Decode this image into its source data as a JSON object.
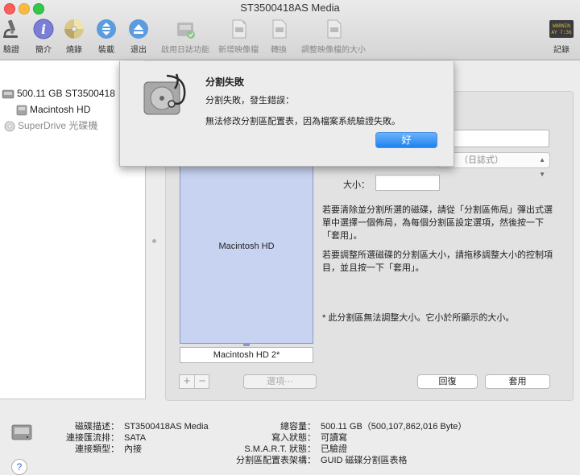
{
  "window": {
    "title": "ST3500418AS Media"
  },
  "toolbar": {
    "items": [
      {
        "label": "驗證",
        "icon": "microscope-icon"
      },
      {
        "label": "簡介",
        "icon": "info-icon"
      },
      {
        "label": "燒錄",
        "icon": "burn-disc-icon"
      },
      {
        "label": "裝載",
        "icon": "mount-icon"
      },
      {
        "label": "退出",
        "icon": "eject-icon"
      },
      {
        "label": "啟用日誌功能",
        "icon": "journal-icon"
      },
      {
        "label": "新增映像檔",
        "icon": "new-image-icon"
      },
      {
        "label": "轉換",
        "icon": "convert-icon"
      },
      {
        "label": "調整映像檔的大小",
        "icon": "resize-image-icon"
      },
      {
        "label": "記錄",
        "icon": "log-icon"
      }
    ],
    "log_icon_text_1": "WARNIN",
    "log_icon_text_2": "AY 7:36"
  },
  "sidebar": {
    "items": [
      {
        "label": "500.11 GB ST3500418",
        "icon": "hard-drive-icon"
      },
      {
        "label": "Macintosh HD",
        "icon": "volume-icon"
      },
      {
        "label": "SuperDrive 光碟機",
        "icon": "optical-drive-icon"
      }
    ]
  },
  "main": {
    "partition_block_label": "Macintosh HD",
    "partition_name_value": "Macintosh HD 2*",
    "format_value": "（日誌式）",
    "size_label": "大小：",
    "size_value": "",
    "name_value": "",
    "help_para1": "若要清除並分割所選的磁碟，請從「分割區佈局」彈出式選單中選擇一個佈局，為每個分割區設定選項，然後按一下「套用」。",
    "help_para2": "若要調整所選磁碟的分割區大小，請拖移調整大小的控制項目，並且按一下「套用」。",
    "note": "* 此分割區無法調整大小。它小於所顯示的大小。",
    "options_button": "選項⋯",
    "revert_button": "回復",
    "apply_button": "套用",
    "plus": "+",
    "minus": "−"
  },
  "info": {
    "disk_desc_label": "磁碟描述：",
    "disk_desc_value": "ST3500418AS Media",
    "bus_label": "連接匯流排：",
    "bus_value": "SATA",
    "conn_type_label": "連接類型：",
    "conn_type_value": "內接",
    "capacity_label": "總容量：",
    "capacity_value": "500.11 GB（500,107,862,016 Byte）",
    "write_label": "寫入狀態：",
    "write_value": "可讀寫",
    "smart_label": "S.M.A.R.T. 狀態：",
    "smart_value": "已驗證",
    "scheme_label": "分割區配置表架構：",
    "scheme_value": "GUID 磁碟分割區表格",
    "help_button": "?"
  },
  "alert": {
    "title": "分割失敗",
    "subtitle": "分割失敗，發生錯誤：",
    "message": "無法修改分割區配置表，因為檔案系統驗證失敗。",
    "ok_button": "好",
    "icon": "disk-utility-icon"
  }
}
